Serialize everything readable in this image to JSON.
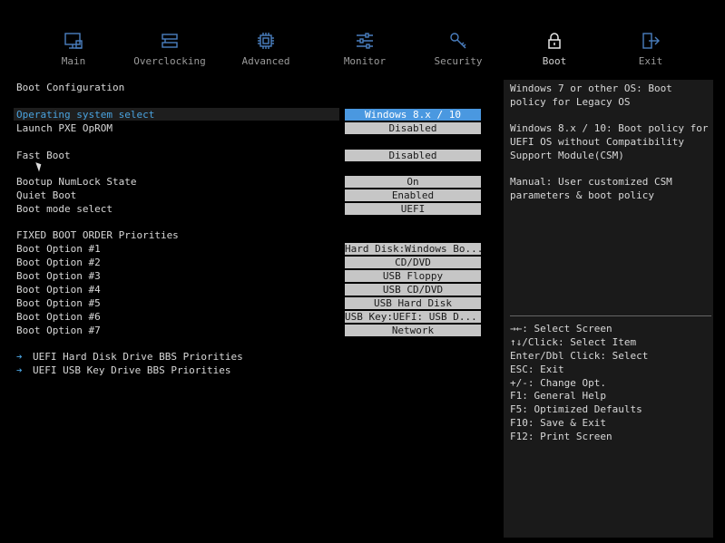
{
  "tabs": [
    {
      "label": "Main",
      "icon": "monitor-icon"
    },
    {
      "label": "Overclocking",
      "icon": "overclock-icon"
    },
    {
      "label": "Advanced",
      "icon": "chip-icon"
    },
    {
      "label": "Monitor",
      "icon": "sliders-icon"
    },
    {
      "label": "Security",
      "icon": "key-icon"
    },
    {
      "label": "Boot",
      "icon": "lock-icon",
      "active": true
    },
    {
      "label": "Exit",
      "icon": "exit-icon"
    }
  ],
  "section_title": "Boot Configuration",
  "settings": [
    {
      "label": "Operating system select",
      "value": "Windows 8.x / 10"
    },
    {
      "label": "Launch PXE OpROM",
      "value": "Disabled"
    },
    {
      "label": "Fast Boot",
      "value": "Disabled"
    },
    {
      "label": "Bootup NumLock State",
      "value": "On"
    },
    {
      "label": "Quiet Boot",
      "value": "Enabled"
    },
    {
      "label": "Boot mode select",
      "value": "UEFI"
    }
  ],
  "priorities_title": "FIXED BOOT ORDER Priorities",
  "boot_options": [
    {
      "label": "Boot Option #1",
      "value": "Hard Disk:Windows Bo..."
    },
    {
      "label": "Boot Option #2",
      "value": "CD/DVD"
    },
    {
      "label": "Boot Option #3",
      "value": "USB Floppy"
    },
    {
      "label": "Boot Option #4",
      "value": "USB CD/DVD"
    },
    {
      "label": "Boot Option #5",
      "value": "USB Hard Disk"
    },
    {
      "label": "Boot Option #6",
      "value": "USB Key:UEFI:  USB D..."
    },
    {
      "label": "Boot Option #7",
      "value": "Network"
    }
  ],
  "submenus": [
    "UEFI Hard Disk Drive BBS Priorities",
    "UEFI USB Key Drive BBS Priorities"
  ],
  "help": {
    "p1": "Windows 7 or other OS: Boot policy for Legacy OS",
    "p2": "Windows 8.x / 10: Boot policy for UEFI OS without Compatibility Support Module(CSM)",
    "p3": "Manual: User customized CSM parameters & boot policy"
  },
  "keys": [
    "→←: Select Screen",
    "↑↓/Click: Select Item",
    "Enter/Dbl Click: Select",
    "ESC: Exit",
    "+/-: Change Opt.",
    "F1: General Help",
    "F5: Optimized Defaults",
    "F10: Save & Exit",
    "F12: Print Screen"
  ],
  "colors": {
    "accent": "#4aa3df",
    "highlight_value": "#4a98e0",
    "value_bg": "#c6c6c6"
  }
}
